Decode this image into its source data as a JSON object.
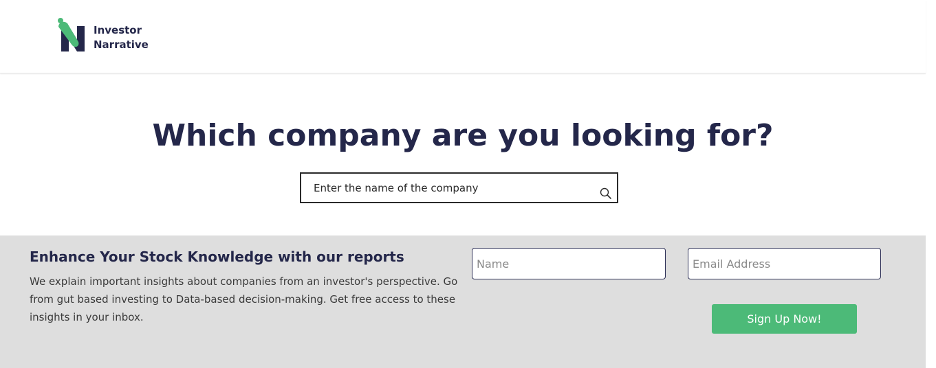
{
  "brand": {
    "line1": "Investor",
    "line2": "Narrative",
    "colors": {
      "navy": "#24274a",
      "green": "#4cba78"
    }
  },
  "hero": {
    "headline": "Which company are you looking for?",
    "search_placeholder": "Enter the name of the company",
    "search_icon": "search-icon"
  },
  "subscribe": {
    "title": "Enhance Your Stock Knowledge with our reports",
    "description": "We explain important insights about companies from an investor's perspective. Go from gut based investing to Data-based decision-making. Get free access to these insights in your inbox.",
    "name_placeholder": "Name",
    "email_placeholder": "Email Address",
    "button_label": "Sign Up Now!",
    "background": "#dedede"
  }
}
